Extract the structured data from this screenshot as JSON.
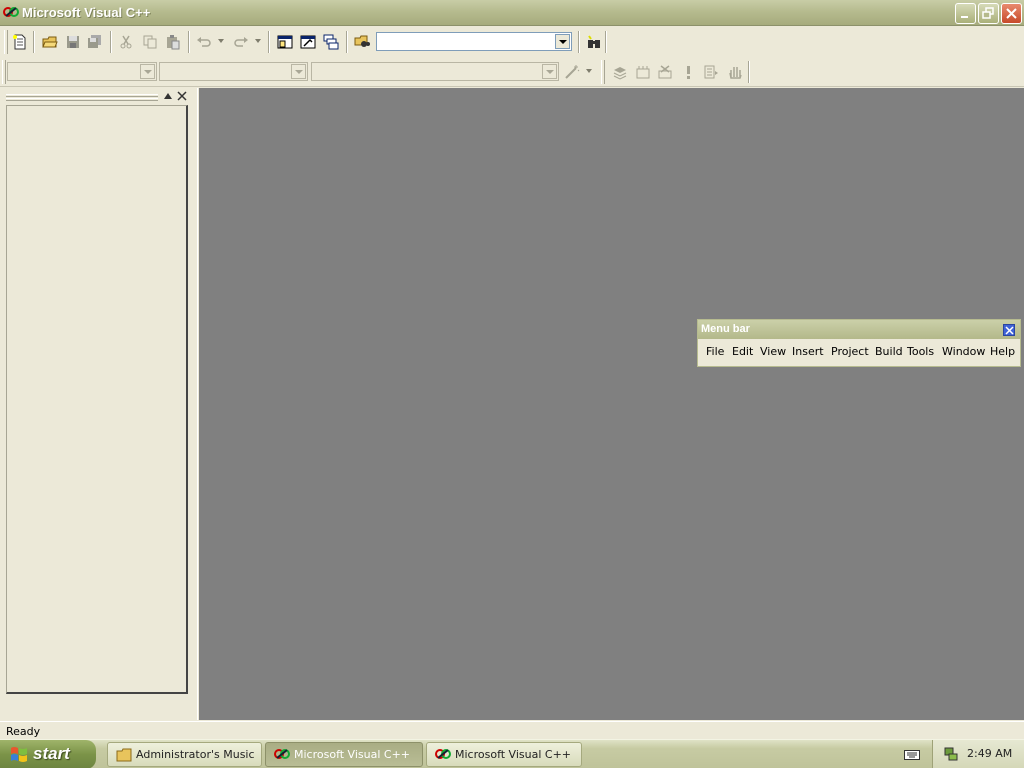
{
  "window": {
    "title": "Microsoft Visual C++"
  },
  "toolbar": {
    "find_combo_value": "",
    "class_combo_value": "",
    "filter_combo_value": "",
    "members_combo_value": ""
  },
  "floating_menubar": {
    "title": "Menu bar",
    "items": [
      {
        "label": "File"
      },
      {
        "label": "Edit"
      },
      {
        "label": "View"
      },
      {
        "label": "Insert"
      },
      {
        "label": "Project"
      },
      {
        "label": "Build"
      },
      {
        "label": "Tools"
      },
      {
        "label": "Window"
      },
      {
        "label": "Help"
      }
    ]
  },
  "statusbar": {
    "text": "Ready"
  },
  "taskbar": {
    "start_label": "start",
    "tasks": [
      {
        "label": "Administrator's Music",
        "active": false
      },
      {
        "label": "Microsoft Visual C++",
        "active": true
      },
      {
        "label": "Microsoft Visual C++",
        "active": false
      }
    ],
    "clock": "2:49 AM"
  },
  "colors": {
    "mdi_background": "#808080",
    "chrome": "#ece9d8",
    "titlebar": "#b6bb8f"
  }
}
